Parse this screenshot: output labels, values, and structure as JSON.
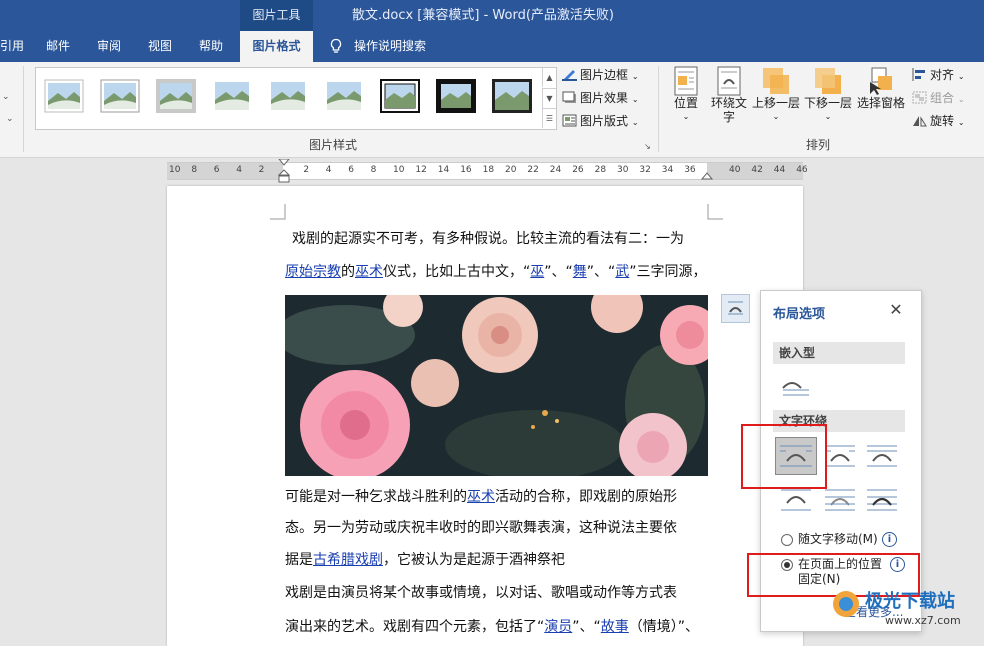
{
  "titlebar": {
    "picture_tools": "图片工具",
    "document_title": "散文.docx [兼容模式]  -  Word(产品激活失败)"
  },
  "tabs": [
    {
      "label": "引用"
    },
    {
      "label": "邮件"
    },
    {
      "label": "审阅"
    },
    {
      "label": "视图"
    },
    {
      "label": "帮助"
    },
    {
      "label": "图片格式"
    },
    {
      "label": "操作说明搜索"
    }
  ],
  "ribbon": {
    "picture_styles_label": "图片样式",
    "border_label": "图片边框",
    "effects_label": "图片效果",
    "layout_label": "图片版式",
    "position_label": "位置",
    "wrap_text_label": "环绕文字",
    "bring_forward_label": "上移一层",
    "send_backward_label": "下移一层",
    "selection_pane_label": "选择窗格",
    "align_label": "对齐",
    "group_label": "组合",
    "rotate_label": "旋转",
    "arrange_label": "排列"
  },
  "ruler": {
    "ticks": [
      "10",
      "8",
      "6",
      "4",
      "2",
      "",
      "2",
      "4",
      "6",
      "8",
      "10",
      "12",
      "14",
      "16",
      "18",
      "20",
      "22",
      "24",
      "26",
      "28",
      "30",
      "32",
      "34",
      "36",
      "",
      "40",
      "42",
      "44",
      "46"
    ]
  },
  "document": {
    "line1": "戏剧的起源实不可考，有多种假说。比较主流的看法有二：一为",
    "line2": {
      "a": "原始宗教",
      "b": "的",
      "c": "巫术",
      "d": "仪式，比如上古中文，“",
      "e": "巫",
      "f": "”、“",
      "g": "舞",
      "h": "”、“",
      "i": "武",
      "j": "”三字同源，"
    },
    "line3": {
      "a": "可能是对一种乞求战斗胜利的",
      "b": "巫术",
      "c": "活动的合称，即戏剧的原始形"
    },
    "line4": "态。另一为劳动或庆祝丰收时的即兴歌舞表演，这种说法主要依",
    "line5": {
      "a": "据是",
      "b": "古希腊戏剧",
      "c": "，它被认为是起源于酒神祭祀"
    },
    "line6": "戏剧是由演员将某个故事或情境，以对话、歌唱或动作等方式表",
    "line7": {
      "a": "演出来的艺术。戏剧有四个元素，包括了“",
      "b": "演员",
      "c": "”、“",
      "d": "故事",
      "e": "（情境）”、"
    }
  },
  "layout_panel": {
    "title": "布局选项",
    "inline_section": "嵌入型",
    "wrap_section": "文字环绕",
    "move_with_text": "随文字移动(M)",
    "fix_position_line1": "在页面上的位置",
    "fix_position_line2": "固定(N)",
    "see_more": "查看更多..."
  },
  "watermark": {
    "text": "极光下载站",
    "url": "www.xz7.com"
  },
  "colors": {
    "accent": "#2b579a",
    "highlight": "#e01b1b",
    "link": "#1a3fb0"
  }
}
